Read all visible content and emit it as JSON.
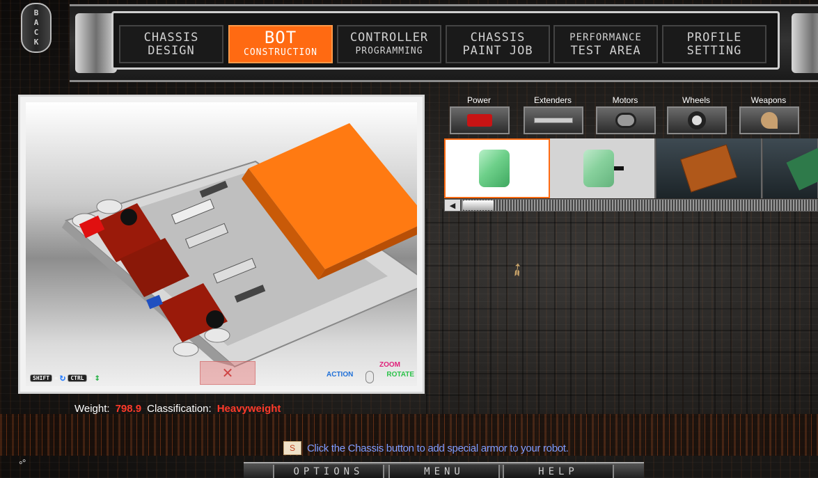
{
  "back": {
    "label": "BACK"
  },
  "nav": {
    "tabs": [
      {
        "line1": "CHASSIS",
        "line2": "DESIGN",
        "active": false
      },
      {
        "line1": "BOT",
        "line2": "CONSTRUCTION",
        "active": true
      },
      {
        "line1": "CONTROLLER",
        "line2": "PROGRAMMING",
        "active": false
      },
      {
        "line1": "CHASSIS",
        "line2": "PAINT JOB",
        "active": false
      },
      {
        "line1": "PERFORMANCE",
        "line2": "TEST AREA",
        "active": false
      },
      {
        "line1": "PROFILE",
        "line2": "SETTING",
        "active": false
      }
    ]
  },
  "viewport": {
    "hints": {
      "shift_key": "SHIFT",
      "ctrl_key": "CTRL",
      "zoom": "ZOOM",
      "action": "ACTION",
      "rotate": "ROTATE"
    }
  },
  "stats": {
    "weight_label": "Weight:",
    "weight_value": "798.9",
    "class_label": "Classification:",
    "class_value": "Heavyweight"
  },
  "parts": {
    "categories": [
      {
        "label": "Power",
        "icon": "battery-icon"
      },
      {
        "label": "Extenders",
        "icon": "extender-bar-icon"
      },
      {
        "label": "Motors",
        "icon": "motor-icon"
      },
      {
        "label": "Wheels",
        "icon": "wheel-icon"
      },
      {
        "label": "Weapons",
        "icon": "weapon-icon"
      }
    ],
    "items": [
      {
        "name": "battery-small",
        "selected": true
      },
      {
        "name": "battery-with-connector",
        "selected": false
      },
      {
        "name": "circuit-board-orange",
        "selected": false
      },
      {
        "name": "circuit-board-green",
        "selected": false
      }
    ]
  },
  "tip": {
    "text": "Click the Chassis button to add special armor to your robot."
  },
  "bottom": {
    "options": "OPTIONS",
    "menu": "MENU",
    "help": "HELP"
  },
  "colors": {
    "accent": "#ff6a12",
    "stat_value": "#ff3a2a",
    "tip_text": "#7f9cff"
  }
}
